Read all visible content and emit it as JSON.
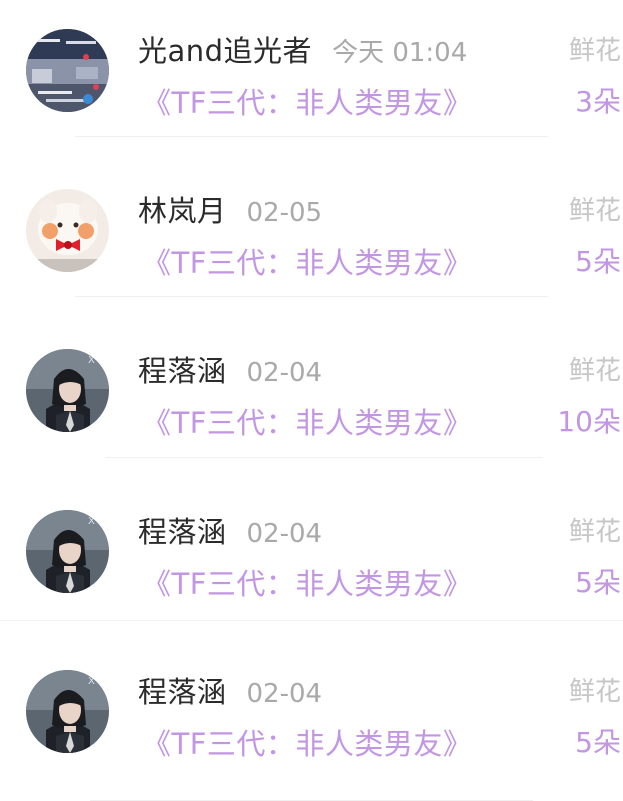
{
  "gifts": [
    {
      "name": "光and追光者",
      "time": "今天 01:04",
      "book": "《TF三代：非人类男友》",
      "gift_label": "鲜花",
      "gift_count": "3朵",
      "avatar_icon": "collage-avatar"
    },
    {
      "name": "林岚月",
      "time": "02-05",
      "book": "《TF三代：非人类男友》",
      "gift_label": "鲜花",
      "gift_count": "5朵",
      "avatar_icon": "plush-toy-avatar"
    },
    {
      "name": "程落涵",
      "time": "02-04",
      "book": "《TF三代：非人类男友》",
      "gift_label": "鲜花",
      "gift_count": "10朵",
      "avatar_icon": "portrait-avatar"
    },
    {
      "name": "程落涵",
      "time": "02-04",
      "book": "《TF三代：非人类男友》",
      "gift_label": "鲜花",
      "gift_count": "5朵",
      "avatar_icon": "portrait-avatar"
    },
    {
      "name": "程落涵",
      "time": "02-04",
      "book": "《TF三代：非人类男友》",
      "gift_label": "鲜花",
      "gift_count": "5朵",
      "avatar_icon": "portrait-avatar"
    }
  ],
  "colors": {
    "accent": "#c296e3",
    "name": "#2b2b2b",
    "muted": "#a9a9a9"
  }
}
